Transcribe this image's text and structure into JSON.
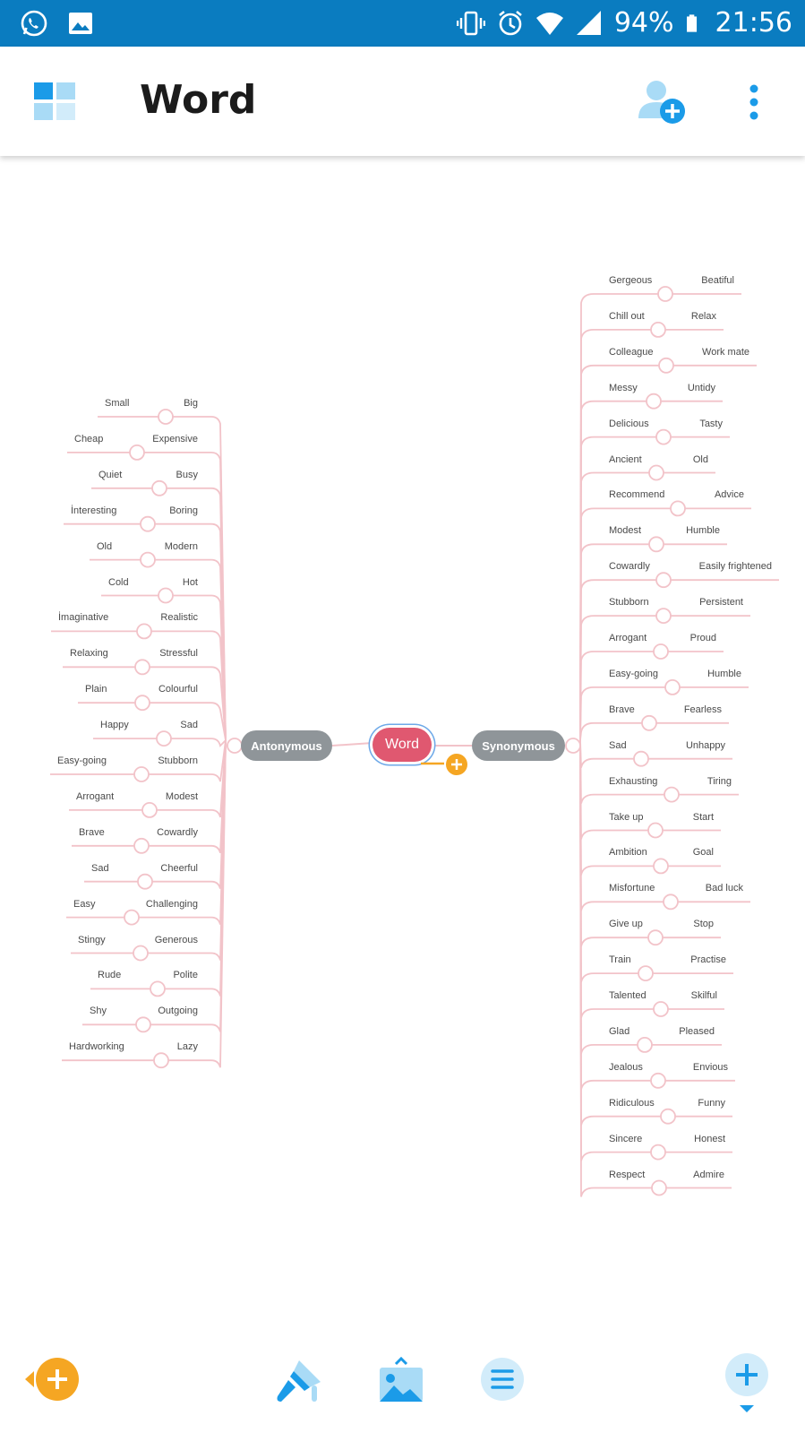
{
  "status": {
    "battery": "94%",
    "time": "21:56"
  },
  "app": {
    "title": "Word"
  },
  "central": "Word",
  "antonyms": {
    "label": "Antonymous",
    "pairs": [
      [
        "Small",
        "Big"
      ],
      [
        "Cheap",
        "Expensive"
      ],
      [
        "Quiet",
        "Busy"
      ],
      [
        "İnteresting",
        "Boring"
      ],
      [
        "Old",
        "Modern"
      ],
      [
        "Cold",
        "Hot"
      ],
      [
        "İmaginative",
        "Realistic"
      ],
      [
        "Relaxing",
        "Stressful"
      ],
      [
        "Plain",
        "Colourful"
      ],
      [
        "Happy",
        "Sad"
      ],
      [
        "Easy-going",
        "Stubborn"
      ],
      [
        "Arrogant",
        "Modest"
      ],
      [
        "Brave",
        "Cowardly"
      ],
      [
        "Sad",
        "Cheerful"
      ],
      [
        "Easy",
        "Challenging"
      ],
      [
        "Stingy",
        "Generous"
      ],
      [
        "Rude",
        "Polite"
      ],
      [
        "Shy",
        "Outgoing"
      ],
      [
        "Hardworking",
        "Lazy"
      ]
    ]
  },
  "synonyms": {
    "label": "Synonymous",
    "pairs": [
      [
        "Gergeous",
        "Beatiful"
      ],
      [
        "Chill out",
        "Relax"
      ],
      [
        "Colleague",
        "Work mate"
      ],
      [
        "Messy",
        "Untidy"
      ],
      [
        "Delicious",
        "Tasty"
      ],
      [
        "Ancient",
        "Old"
      ],
      [
        "Recommend",
        "Advice"
      ],
      [
        "Modest",
        "Humble"
      ],
      [
        "Cowardly",
        "Easily frightened"
      ],
      [
        "Stubborn",
        "Persistent"
      ],
      [
        "Arrogant",
        "Proud"
      ],
      [
        "Easy-going",
        "Humble"
      ],
      [
        "Brave",
        "Fearless"
      ],
      [
        "Sad",
        "Unhappy"
      ],
      [
        "Exhausting",
        "Tiring"
      ],
      [
        "Take up",
        "Start"
      ],
      [
        "Ambition",
        "Goal"
      ],
      [
        "Misfortune",
        "Bad luck"
      ],
      [
        "Give up",
        "Stop"
      ],
      [
        "Train",
        "Practise"
      ],
      [
        "Talented",
        "Skilful"
      ],
      [
        "Glad",
        "Pleased"
      ],
      [
        "Jealous",
        "Envious"
      ],
      [
        "Ridiculous",
        "Funny"
      ],
      [
        "Sincere",
        "Honest"
      ],
      [
        "Respect",
        "Admire"
      ]
    ]
  },
  "colors": {
    "statusbar": "#0a7cc0",
    "accent_blue": "#1b9be8",
    "central_node": "#e05870",
    "topic_node": "#8f9599",
    "branch_line": "#f2c3c9",
    "add_orange": "#f5a623"
  },
  "icons": {
    "status": [
      "whatsapp-icon",
      "gallery-icon",
      "vibrate-icon",
      "alarm-icon",
      "wifi-icon",
      "signal-icon",
      "battery-icon"
    ],
    "appbar": [
      "grid-icon",
      "add-user-icon",
      "more-vert-icon"
    ],
    "bottom": [
      "add-topic-icon",
      "paint-icon",
      "image-icon",
      "outline-icon",
      "add-icon"
    ]
  }
}
